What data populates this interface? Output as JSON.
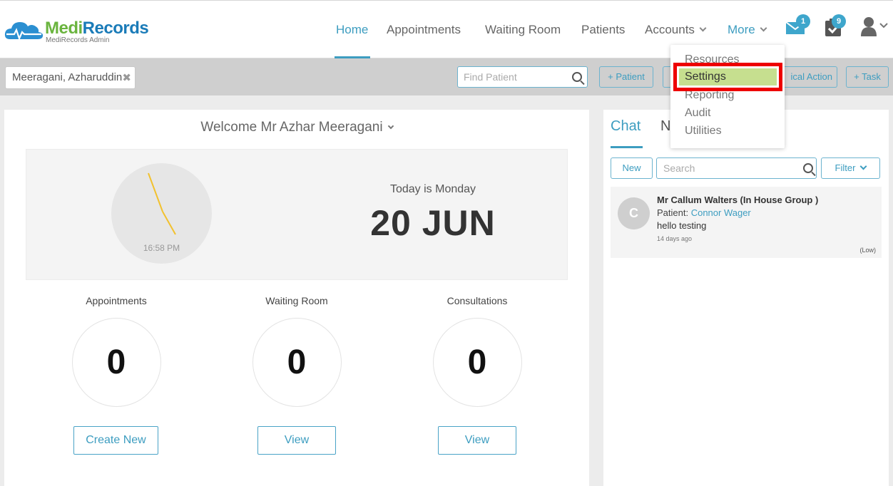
{
  "app": {
    "logo_brand_medi": "Medi",
    "logo_brand_records": "Records",
    "logo_subtitle": "MediRecords Admin"
  },
  "nav": {
    "home": "Home",
    "appointments": "Appointments",
    "waiting_room": "Waiting Room",
    "patients": "Patients",
    "accounts": "Accounts",
    "more": "More",
    "mail_badge": "1",
    "tasks_badge": "9"
  },
  "more_menu": {
    "items": [
      "Resources",
      "Settings",
      "Reporting",
      "Audit",
      "Utilities"
    ],
    "selected": "Settings"
  },
  "toolbar": {
    "patient_chip": "Meeragani, Azharuddin",
    "find_placeholder": "Find Patient",
    "add_patient": "+ Patient",
    "clinical_action": "ical Action",
    "add_task": "+ Task"
  },
  "dashboard": {
    "welcome": "Welcome Mr Azhar Meeragani",
    "clock_time": "16:58 PM",
    "today_label": "Today is Monday",
    "date": "20 JUN",
    "stats": [
      {
        "label": "Appointments",
        "value": "0",
        "button": "Create New"
      },
      {
        "label": "Waiting Room",
        "value": "0",
        "button": "View"
      },
      {
        "label": "Consultations",
        "value": "0",
        "button": "View"
      }
    ]
  },
  "chat": {
    "tab_chat": "Chat",
    "tab_other_partial": "N",
    "new_button": "New",
    "search_placeholder": "Search",
    "filter_button": "Filter",
    "message": {
      "avatar_letter": "C",
      "sender": "Mr Callum Walters (In House Group )",
      "patient_label": "Patient: ",
      "patient_name": "Connor Wager",
      "text": "hello testing",
      "time": "14 days ago",
      "priority": "(Low)"
    }
  },
  "colors": {
    "accent": "#3d9dc0",
    "brand_green": "#6ab43e",
    "brand_blue": "#1a7bb8",
    "highlight_border": "#e00000",
    "highlight_fill": "#c6df8f"
  }
}
